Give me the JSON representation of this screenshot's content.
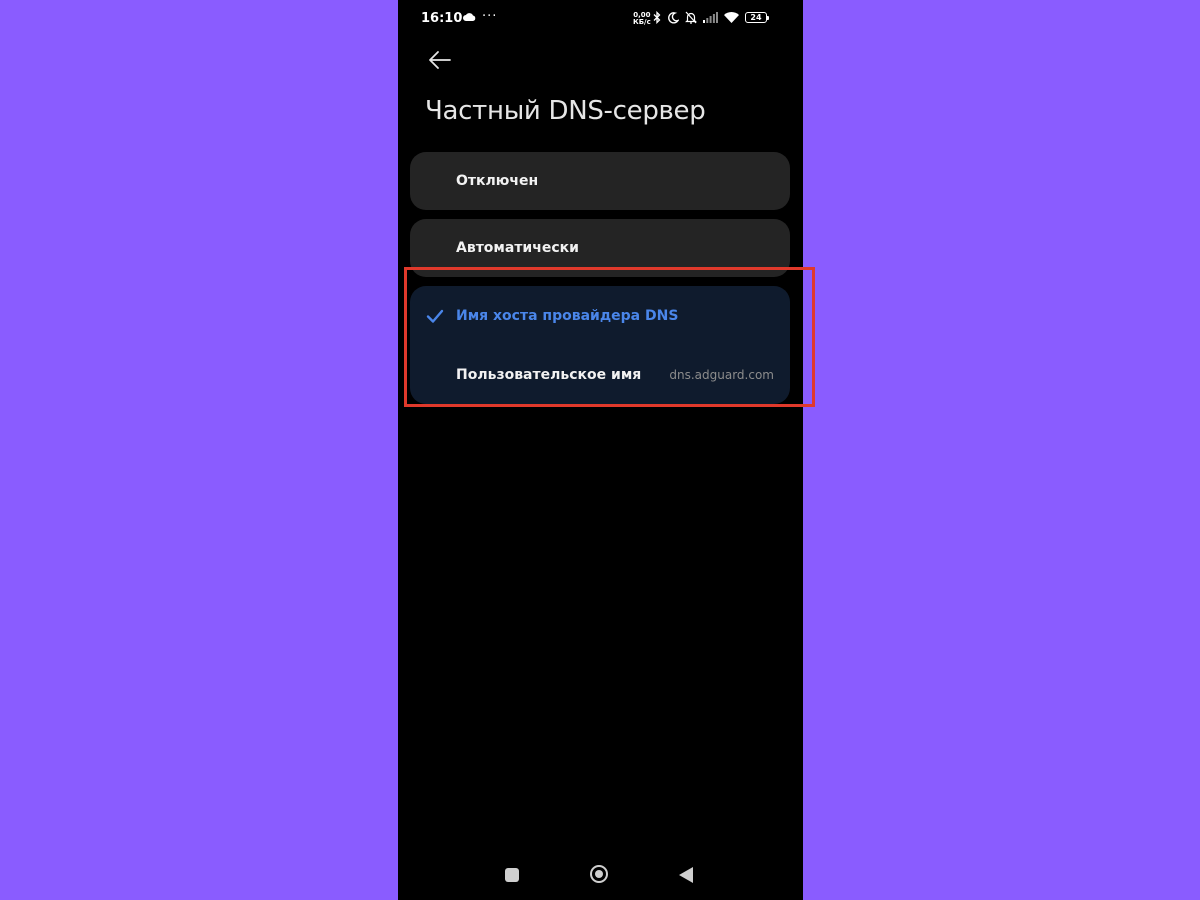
{
  "status_bar": {
    "time": "16:10",
    "more": "···",
    "net_speed_value": "0,00",
    "net_speed_unit": "КБ/с",
    "battery_level": "24",
    "icons": [
      "cloud-icon",
      "bluetooth-icon",
      "moon-icon",
      "bell-off-icon",
      "signal-icon",
      "wifi-icon",
      "battery-icon"
    ]
  },
  "header": {
    "back_icon": "arrow-left-icon",
    "title": "Частный DNS-сервер"
  },
  "options": {
    "off_label": "Отключен",
    "auto_label": "Автоматически",
    "hostname_label": "Имя хоста провайдера DNS",
    "custom_label": "Пользовательское имя",
    "custom_value": "dns.adguard.com"
  },
  "colors": {
    "background": "#8a5cff",
    "screen": "#000000",
    "card": "#242424",
    "selected_card": "#0f1b2d",
    "accent": "#4a86ea",
    "highlight": "#e0392b"
  },
  "navigation": {
    "recent_icon": "square-icon",
    "home_icon": "circle-icon",
    "back_icon": "triangle-back-icon"
  }
}
